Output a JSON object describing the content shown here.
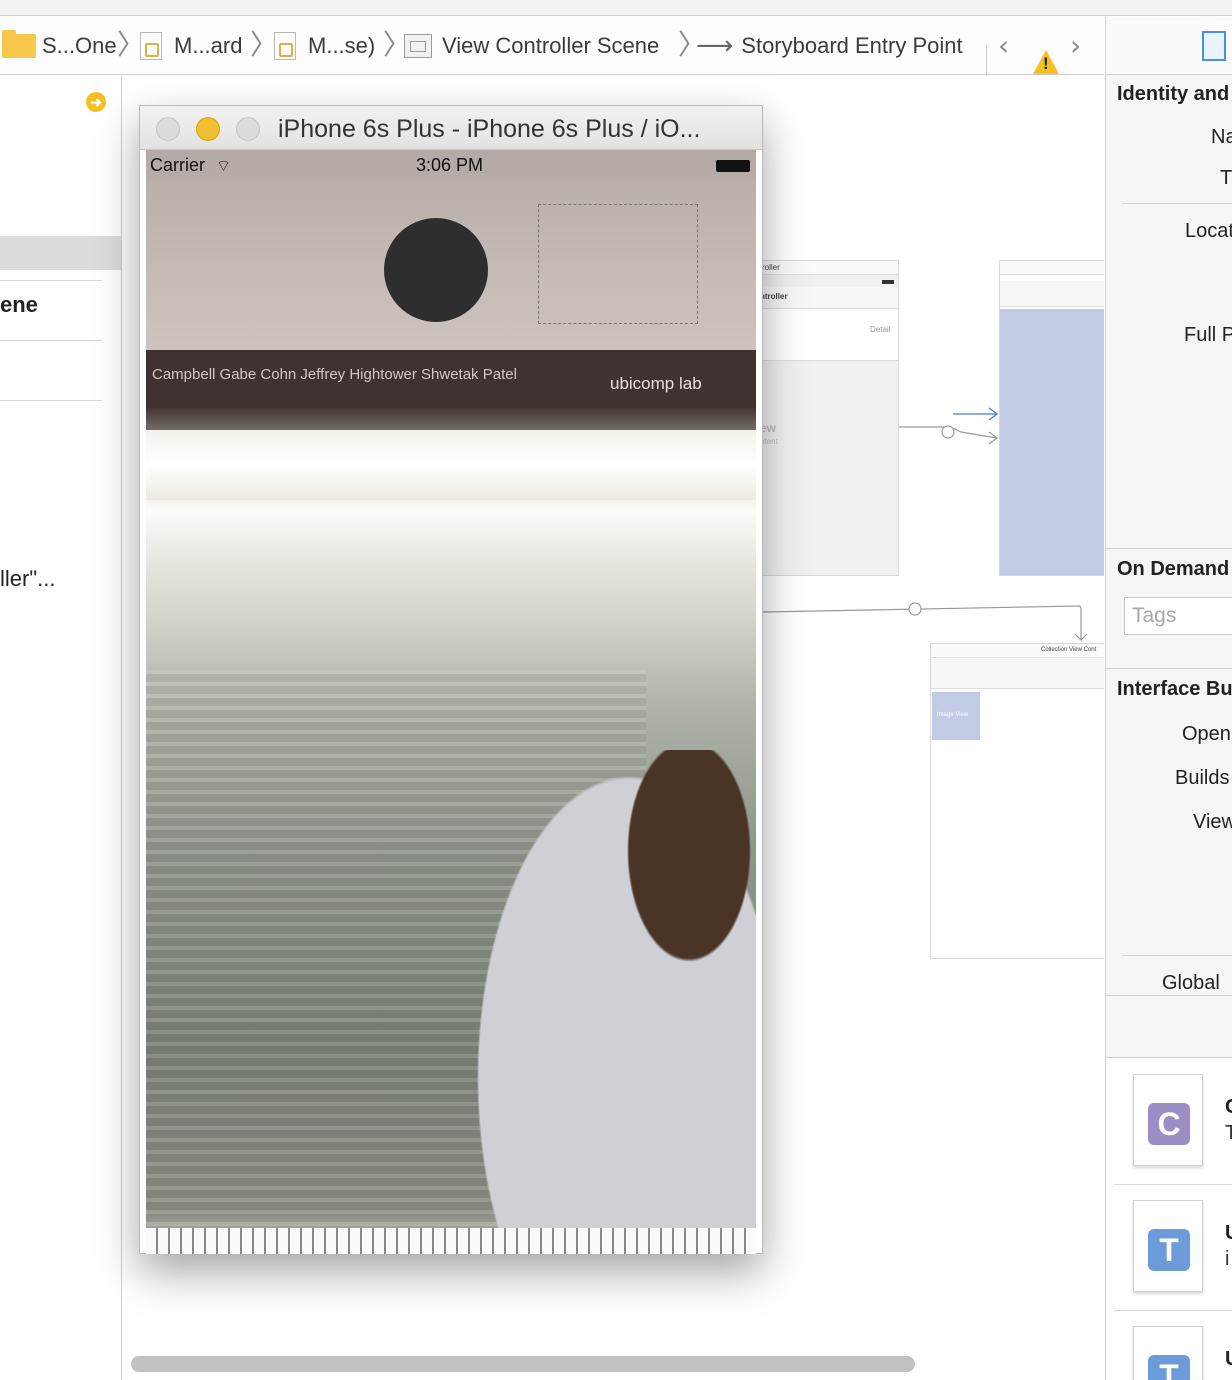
{
  "jumpbar": {
    "crumbs": [
      {
        "label": "S...One",
        "icon": "folder-icon"
      },
      {
        "label": "M...ard",
        "icon": "storyboard-file-icon"
      },
      {
        "label": "M...se)",
        "icon": "storyboard-file-icon"
      },
      {
        "label": "View Controller Scene",
        "icon": "scene-icon"
      },
      {
        "label": "Storyboard Entry Point",
        "icon": "entry-arrow-icon"
      }
    ],
    "separator": "〉",
    "back_glyph": "‹",
    "forward_glyph": "›",
    "warning_glyph": "!"
  },
  "outline": {
    "go_glyph": "➜",
    "scene_label": "ene",
    "controller_label": "ller\"..."
  },
  "canvas": {
    "scene1_title": "roller",
    "scene1_subtitle": "ntroller",
    "scene1_detail": "Detail",
    "scene1_view": "ew",
    "scene1_content": "ntent",
    "collection_title": "Collection View Cont",
    "image_view_label": "Image View"
  },
  "simulator": {
    "title": "iPhone 6s Plus - iPhone 6s Plus / iO...",
    "status": {
      "carrier": "Carrier",
      "wifi_glyph": "⌔",
      "time": "3:06 PM"
    },
    "poster_names": "Campbell  Gabe Cohn  Jeffrey Hightower  Shwetak Patel",
    "poster_lab": "ubicomp lab"
  },
  "inspector": {
    "identity_section": "Identity and",
    "name_label": "Na",
    "type_label": "T",
    "location_label": "Locat",
    "full_path_label": "Full P",
    "on_demand_section": "On Demand",
    "tags_placeholder": "Tags",
    "interface_builder_section": "Interface Bu",
    "opens_label": "Open",
    "builds_label": "Builds",
    "view_label": "View",
    "global_label": "Global",
    "library": [
      {
        "badge": "C",
        "color": "#9b8ec4",
        "name": "C",
        "sub": "T"
      },
      {
        "badge": "T",
        "color": "#6d9ad9",
        "name": "U",
        "sub": "i"
      },
      {
        "badge": "T",
        "color": "#6d9ad9",
        "name": "U",
        "sub": ""
      }
    ]
  },
  "colors": {
    "accent_yellow": "#f5c021",
    "placeholder_blue": "#c1cbe3",
    "segue_blue": "#4a7ed0"
  }
}
